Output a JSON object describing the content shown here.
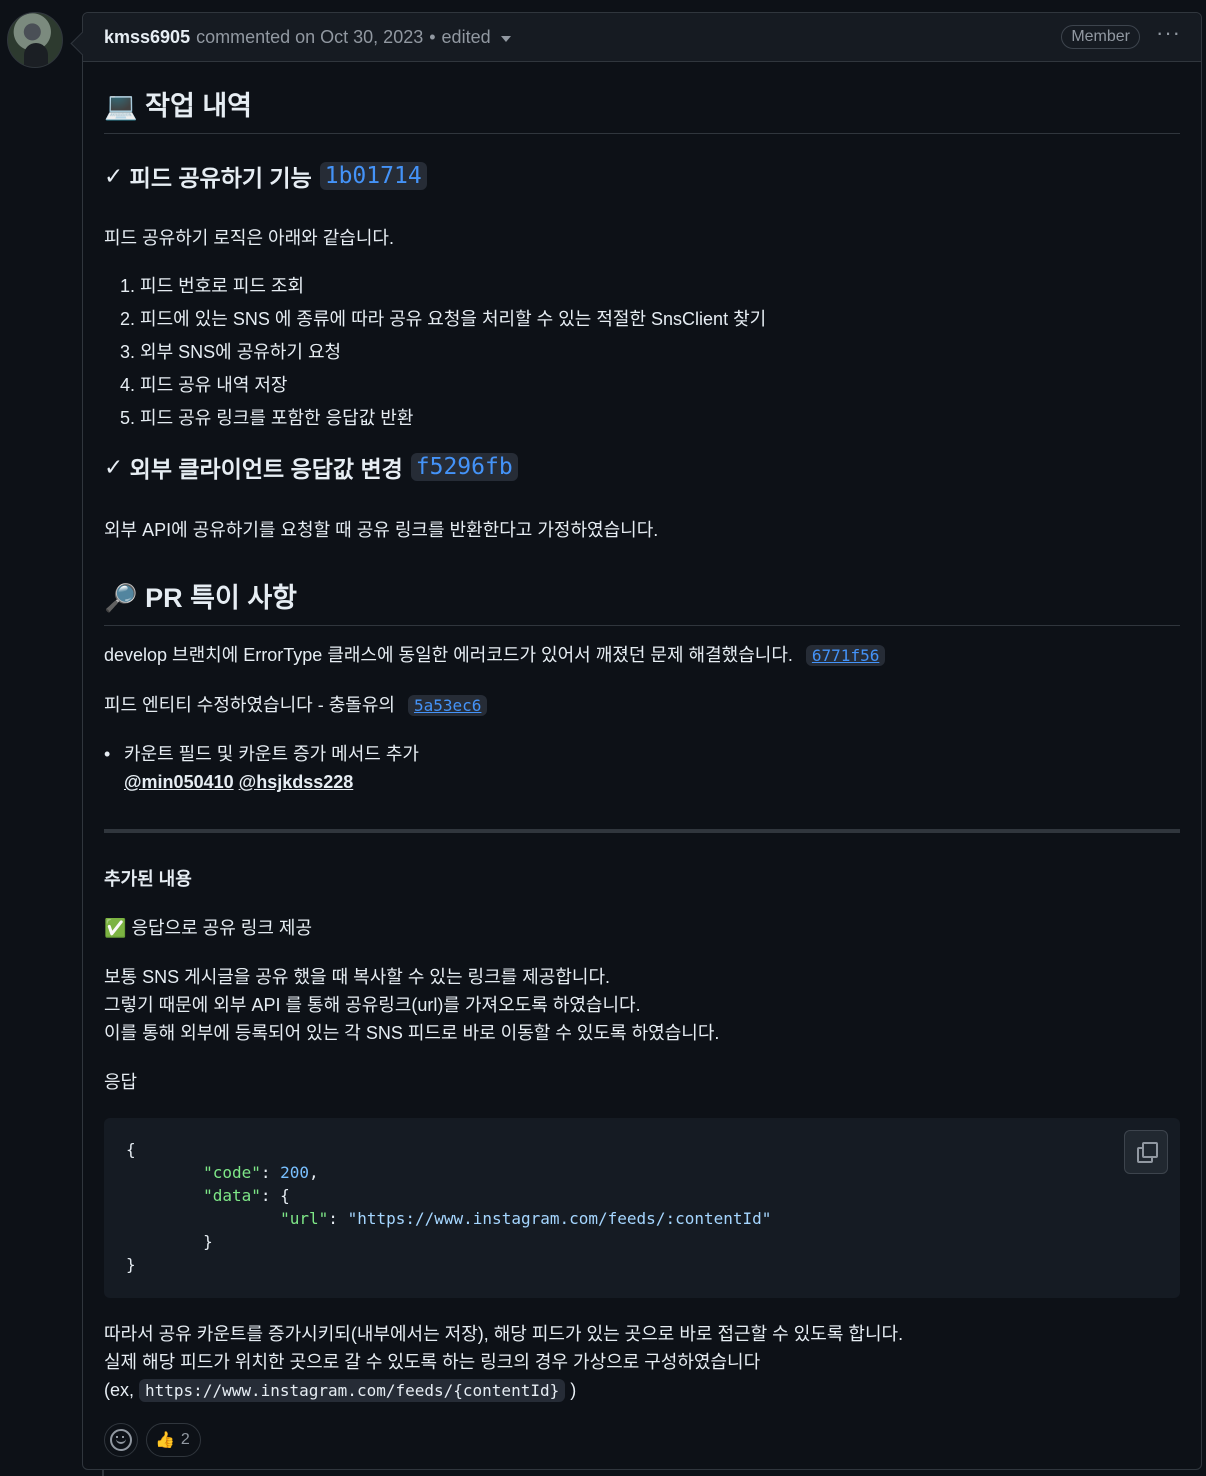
{
  "comment": {
    "author": "kmss6905",
    "action": "commented on Oct 30, 2023",
    "separator": "•",
    "edited": "edited",
    "role_badge": "Member",
    "menu": "···"
  },
  "section1": {
    "icon": "💻",
    "title": "작업 내역",
    "feature1": {
      "check": "✓",
      "title": "피드 공유하기 기능",
      "sha": "1b01714",
      "desc": "피드 공유하기 로직은 아래와 같습니다.",
      "steps": [
        "1. 피드 번호로 피드 조회",
        "2. 피드에 있는 SNS 에 종류에 따라 공유 요청을 처리할 수 있는 적절한 SnsClient 찾기",
        "3. 외부 SNS에 공유하기 요청",
        "4. 피드 공유 내역 저장",
        "5. 피드 공유 링크를 포함한 응답값 반환"
      ]
    },
    "feature2": {
      "check": "✓",
      "title": "외부 클라이언트 응답값 변경",
      "sha": "f5296fb",
      "desc": "외부 API에 공유하기를 요청할 때 공유 링크를 반환한다고 가정하였습니다."
    }
  },
  "section2": {
    "icon": "🔎",
    "title": "PR 특이 사항",
    "line1": "develop 브랜치에 ErrorType 클래스에 동일한 에러코드가 있어서 깨졌던 문제 해결했습니다.",
    "line1_sha": "6771f56",
    "line2": "피드 엔티티 수정하였습니다 - 충돌유의",
    "line2_sha": "5a53ec6",
    "bullet": "카운트 필드 및 카운트 증가 메서드 추가",
    "mention1": "@min050410",
    "mention2": "@hsjkdss228"
  },
  "section3": {
    "title": "추가된 내용",
    "check_icon": "✅",
    "item": "응답으로 공유 링크 제공",
    "para1": [
      "보통 SNS 게시글을 공유 했을 때 복사할 수 있는 링크를 제공합니다.",
      "그렇기 때문에 외부 API 를 통해 공유링크(url)를 가져오도록 하였습니다.",
      "이를 통해 외부에 등록되어 있는 각 SNS 피드로 바로 이동할 수 있도록 하였습니다."
    ],
    "response_label": "응답",
    "code": {
      "open": "{",
      "code_key": "\"code\"",
      "code_val": "200",
      "data_key": "\"data\"",
      "url_key": "\"url\"",
      "url_val": "\"https://www.instagram.com/feeds/:contentId\"",
      "inner_close": "}",
      "close": "}"
    },
    "para2": [
      "따라서 공유 카운트를 증가시키되(내부에서는 저장), 해당 피드가 있는 곳으로 바로 접근할 수 있도록 합니다.",
      "실제 해당 피드가 위치한 곳으로 갈 수 있도록 하는 링크의 경우 가상으로 구성하였습니다"
    ],
    "example_prefix": "(ex, ",
    "example_code": "https://www.instagram.com/feeds/{contentId}",
    "example_suffix": " )"
  },
  "reactions": {
    "thumbs_emoji": "👍",
    "thumbs_count": "2"
  }
}
